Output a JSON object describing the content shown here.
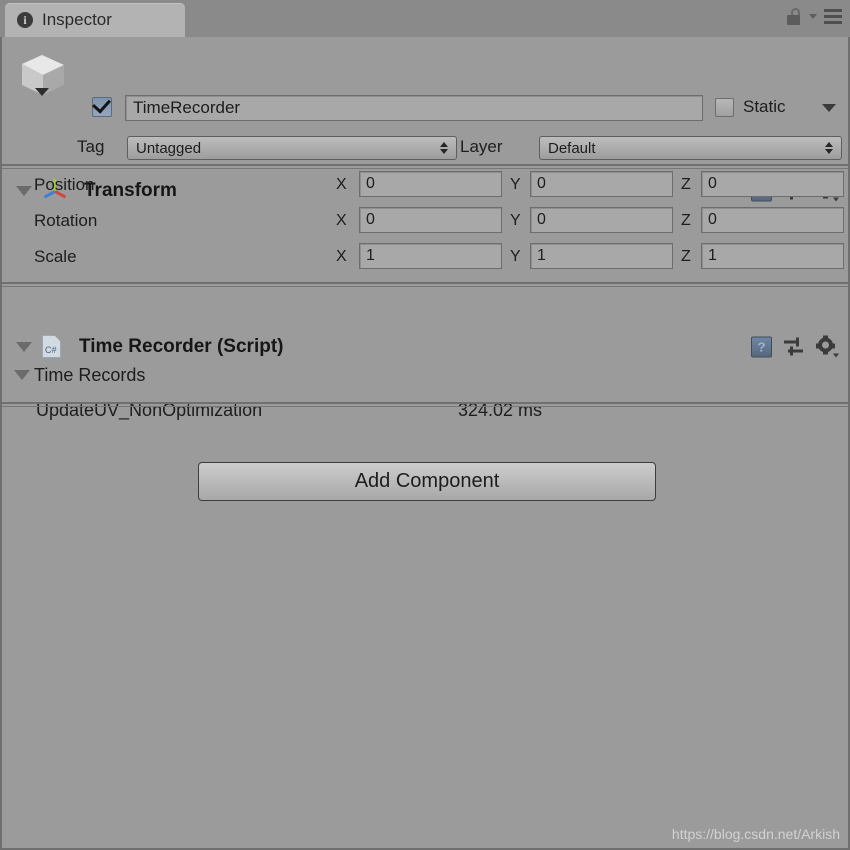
{
  "window": {
    "tab_label": "Inspector",
    "tab_icon": "info-circle-icon",
    "lock_icon": "padlock-icon",
    "menu_icon": "hamburger-menu-icon"
  },
  "gameobject": {
    "icon": "cube-icon",
    "active_checked": true,
    "name": "TimeRecorder",
    "static_label": "Static",
    "static_checked": false,
    "tag_label": "Tag",
    "tag_value": "Untagged",
    "layer_label": "Layer",
    "layer_value": "Default"
  },
  "components": [
    {
      "title": "Transform",
      "icon": "transform-axis-icon",
      "expanded": true,
      "rows": [
        {
          "label": "Position",
          "x": "0",
          "y": "0",
          "z": "0"
        },
        {
          "label": "Rotation",
          "x": "0",
          "y": "0",
          "z": "0"
        },
        {
          "label": "Scale",
          "x": "1",
          "y": "1",
          "z": "1"
        }
      ],
      "axis_labels": {
        "x": "X",
        "y": "Y",
        "z": "Z"
      }
    },
    {
      "title": "Time Recorder (Script)",
      "icon": "csharp-script-icon",
      "expanded": true,
      "list_label": "Time Records",
      "records": [
        {
          "name": "UpdateUV_NonOptimization",
          "value": "324.02 ms"
        }
      ]
    }
  ],
  "component_tools": {
    "help_glyph": "?",
    "help_icon": "help-book-icon",
    "preset_icon": "preset-sliders-icon",
    "settings_icon": "gear-icon"
  },
  "add_component": {
    "label": "Add Component"
  },
  "watermark": {
    "text": "https://blog.csdn.net/Arkish"
  },
  "colors": {
    "panel_bg": "#9b9b9b",
    "tabstrip_bg": "#8a8a8a",
    "tab_bg": "#b3b3b3",
    "field_bg": "#a8a8a8",
    "border": "#6f6f6f",
    "accent_check": "#7e94ae",
    "axis_x": "#d5453f",
    "axis_y": "#9ec93a",
    "axis_z": "#3f7fd5"
  }
}
